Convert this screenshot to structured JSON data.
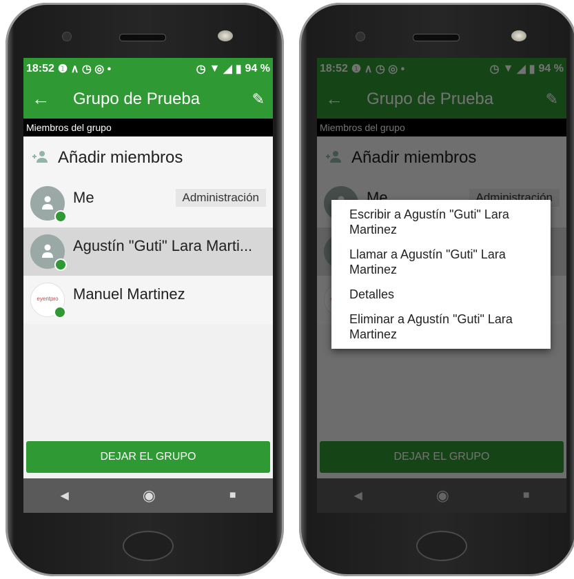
{
  "status": {
    "time": "18:52",
    "battery": "94 %"
  },
  "appbar": {
    "title": "Grupo de Prueba"
  },
  "section": {
    "label": "Miembros del grupo"
  },
  "add": {
    "label": "Añadir miembros"
  },
  "members": [
    {
      "name": "Me",
      "badge": "Administración"
    },
    {
      "name": "Agustín \"Guti\" Lara Marti..."
    },
    {
      "name": "Manuel Martinez",
      "logo_text": "eyentpro"
    }
  ],
  "leave": {
    "label": "DEJAR EL GRUPO"
  },
  "menu": {
    "items": [
      "Escribir a Agustín \"Guti\" Lara Martinez",
      "Llamar a Agustín \"Guti\" Lara Martinez",
      "Detalles",
      "Eliminar a Agustín \"Guti\" Lara Martinez"
    ]
  },
  "colors": {
    "primary": "#2f9a34",
    "section": "#000000"
  }
}
